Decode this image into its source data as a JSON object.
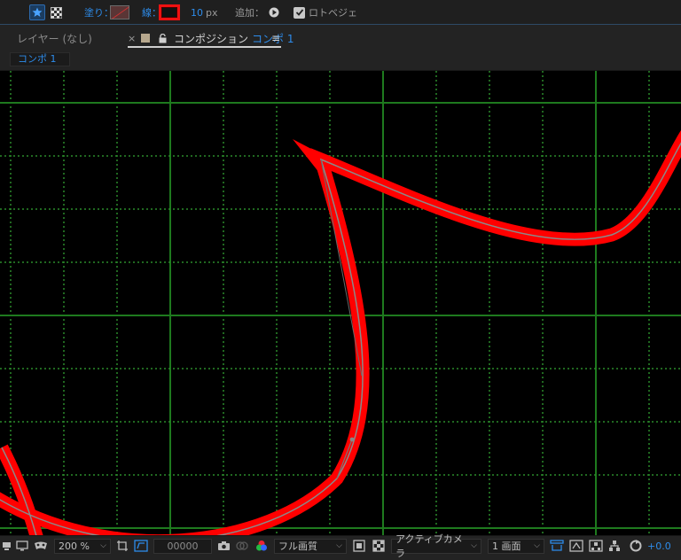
{
  "toolbar": {
    "fill_label": "塗り：",
    "stroke_label": "線：",
    "stroke_width_value": "10",
    "stroke_width_unit": "px",
    "add_label": "追加：",
    "rotobezier_label": "ロトベジェ",
    "rotobezier_checked": true
  },
  "tabs": {
    "layer_tab_label": "レイヤー (なし)",
    "close_glyph": "×",
    "comp_prefix": "コンポジション",
    "comp_name": "コンポ 1",
    "menu_glyph": "≡"
  },
  "comp_chip": "コンポ 1",
  "statusbar": {
    "zoom": "200 %",
    "timecode": "00000",
    "resolution": "フル画質",
    "camera": "アクティブカメラ",
    "views": "1 画面",
    "exposure": "+0.0"
  },
  "colors": {
    "accent": "#2d8ceb",
    "stroke": "#ff0000",
    "grid_major": "#1e7a1e",
    "grid_minor": "#2a8a2a",
    "viewer_bg": "#000000"
  },
  "icons": [
    "star-icon",
    "checker-icon",
    "play-triangle-icon",
    "check-icon",
    "solid-square-icon",
    "lock-icon",
    "monitor-icon",
    "mask-icon",
    "crop-icon",
    "region-icon",
    "camera-icon",
    "snapshot-icon",
    "color-wheel-icon",
    "square-icon",
    "transparency-grid-icon",
    "camera-rig-icon",
    "fast-preview-icon",
    "comp-flow-icon",
    "flowchart-icon",
    "reset-exposure-icon"
  ]
}
